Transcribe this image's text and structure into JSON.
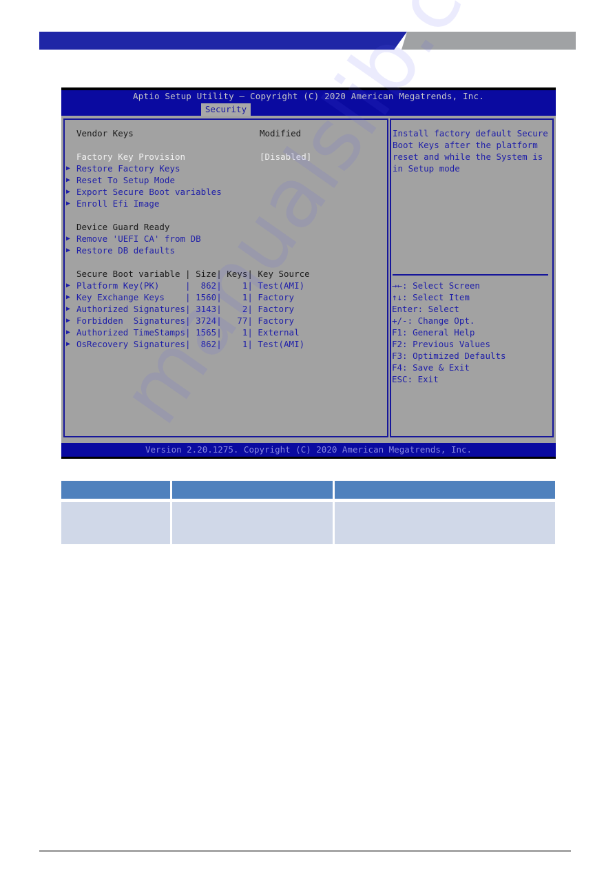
{
  "colors": {
    "header_blue": "#1f26a6",
    "header_grey": "#a0a2a4",
    "bios_blue": "#0a0aa0",
    "bios_grey": "#a2a2a2",
    "item_blue": "#1e1ea8",
    "table_header": "#4f81bd",
    "table_cell": "#d0d8e8"
  },
  "bios": {
    "title": "Aptio Setup Utility – Copyright (C) 2020 American Megatrends, Inc.",
    "active_tab": "Security",
    "footer": "Version 2.20.1275. Copyright (C) 2020 American Megatrends, Inc.",
    "vendor_keys": {
      "label": "Vendor Keys",
      "value": "Modified"
    },
    "factory_key_provision": {
      "label": "Factory Key Provision",
      "value": "[Disabled]"
    },
    "submenus": [
      {
        "label": "Restore Factory Keys"
      },
      {
        "label": "Reset To Setup Mode"
      },
      {
        "label": "Export Secure Boot variables"
      },
      {
        "label": "Enroll Efi Image"
      }
    ],
    "device_guard": {
      "label": "Device Guard Ready",
      "items": [
        {
          "label": "Remove 'UEFI CA' from DB"
        },
        {
          "label": "Restore DB defaults"
        }
      ]
    },
    "variables_table": {
      "header": "Secure Boot variable | Size| Keys| Key Source",
      "rows": [
        {
          "text": "Platform Key(PK)     |  862|    1| Test(AMI)"
        },
        {
          "text": "Key Exchange Keys    | 1560|    1| Factory"
        },
        {
          "text": "Authorized Signatures| 3143|    2| Factory"
        },
        {
          "text": "Forbidden  Signatures| 3724|   77| Factory"
        },
        {
          "text": "Authorized TimeStamps| 1565|    1| External"
        },
        {
          "text": "OsRecovery Signatures|  862|    1| Test(AMI)"
        }
      ]
    },
    "help_text": [
      "Install factory default Secure",
      "Boot Keys after the platform",
      "reset and while the System is",
      "in Setup mode"
    ],
    "key_hints": [
      "→←: Select Screen",
      "↑↓: Select Item",
      "Enter: Select",
      "+/-: Change Opt.",
      "F1: General Help",
      "F2: Previous Values",
      "F3: Optimized Defaults",
      "F4: Save & Exit",
      "ESC: Exit"
    ],
    "submenu_arrow_icon": "▶"
  },
  "watermark": "manualslib.com"
}
